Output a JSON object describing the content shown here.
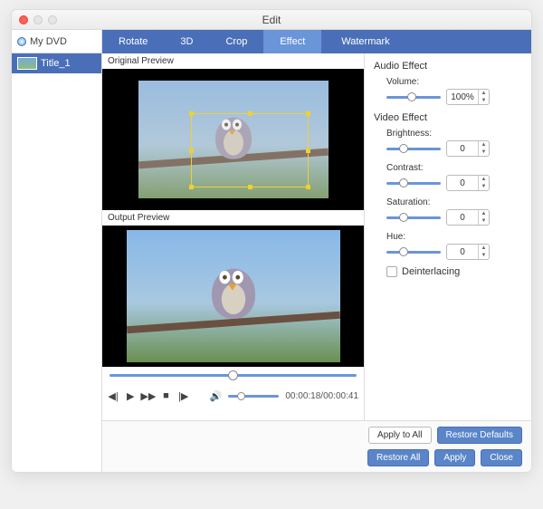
{
  "window": {
    "title": "Edit"
  },
  "sidebar": {
    "drive_label": "My DVD",
    "items": [
      {
        "label": "Title_1"
      }
    ]
  },
  "tabs": [
    {
      "id": "rotate",
      "label": "Rotate",
      "active": false
    },
    {
      "id": "3d",
      "label": "3D",
      "active": false
    },
    {
      "id": "crop",
      "label": "Crop",
      "active": false
    },
    {
      "id": "effect",
      "label": "Effect",
      "active": true
    },
    {
      "id": "watermark",
      "label": "Watermark",
      "active": false
    }
  ],
  "previews": {
    "original_label": "Original Preview",
    "output_label": "Output Preview"
  },
  "player": {
    "time_current": "00:00:18",
    "time_total": "00:00:41",
    "time_sep": "/",
    "position_pct": 48,
    "volume_pct": 18
  },
  "effects": {
    "audio_title": "Audio Effect",
    "volume_label": "Volume:",
    "volume_value": "100%",
    "volume_pct": 38,
    "video_title": "Video Effect",
    "brightness_label": "Brightness:",
    "brightness_value": "0",
    "brightness_pct": 24,
    "contrast_label": "Contrast:",
    "contrast_value": "0",
    "contrast_pct": 24,
    "saturation_label": "Saturation:",
    "saturation_value": "0",
    "saturation_pct": 24,
    "hue_label": "Hue:",
    "hue_value": "0",
    "hue_pct": 24,
    "deinterlace_label": "Deinterlacing",
    "deinterlace_checked": false
  },
  "buttons": {
    "apply_all": "Apply to All",
    "restore_defaults": "Restore Defaults",
    "restore_all": "Restore All",
    "apply": "Apply",
    "close": "Close"
  }
}
